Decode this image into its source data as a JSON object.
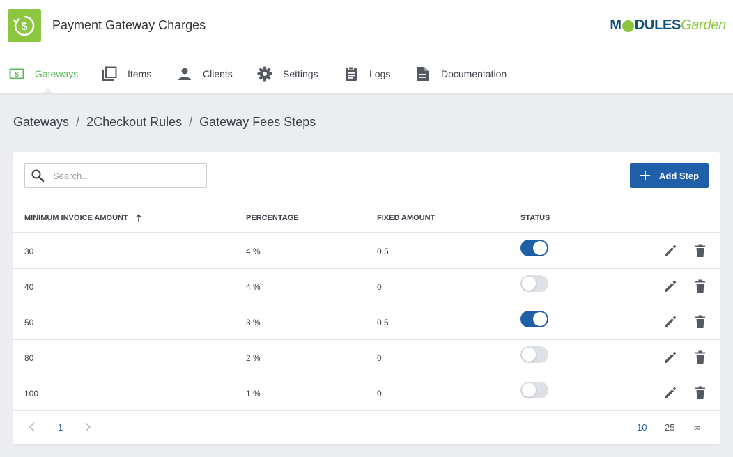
{
  "header": {
    "app_title": "Payment Gateway Charges",
    "app_icon": "dollar-refresh-icon",
    "brand_primary": "M",
    "brand_mid": "DULES",
    "brand_secondary": "Garden",
    "colors": {
      "brand_green": "#8cc63f",
      "brand_blue": "#0d4e7a"
    }
  },
  "nav": {
    "items": [
      {
        "label": "Gateways",
        "icon": "money-icon",
        "active": true
      },
      {
        "label": "Items",
        "icon": "stacked-squares-icon"
      },
      {
        "label": "Clients",
        "icon": "person-icon"
      },
      {
        "label": "Settings",
        "icon": "gear-icon"
      },
      {
        "label": "Logs",
        "icon": "clipboard-icon"
      },
      {
        "label": "Documentation",
        "icon": "document-icon"
      }
    ],
    "active_color": "#5cb85c"
  },
  "breadcrumb": {
    "items": [
      "Gateways",
      "2Checkout Rules",
      "Gateway Fees Steps"
    ],
    "separator": "/"
  },
  "toolbar": {
    "search_placeholder": "Search...",
    "add_label": "Add Step",
    "accent": "#1f5fa8"
  },
  "table": {
    "columns": [
      "MINIMUM INVOICE AMOUNT",
      "PERCENTAGE",
      "FIXED AMOUNT",
      "STATUS"
    ],
    "sort_icon": "arrow-up-icon",
    "rows": [
      {
        "min": "30",
        "pct": "4 %",
        "fixed": "0.5",
        "status": true
      },
      {
        "min": "40",
        "pct": "4 %",
        "fixed": "0",
        "status": false
      },
      {
        "min": "50",
        "pct": "3 %",
        "fixed": "0.5",
        "status": true
      },
      {
        "min": "80",
        "pct": "2 %",
        "fixed": "0",
        "status": false
      },
      {
        "min": "100",
        "pct": "1 %",
        "fixed": "0",
        "status": false
      }
    ]
  },
  "pagination": {
    "current_page": "1",
    "page_sizes": [
      "10",
      "25",
      "∞"
    ],
    "selected_size": "10"
  }
}
